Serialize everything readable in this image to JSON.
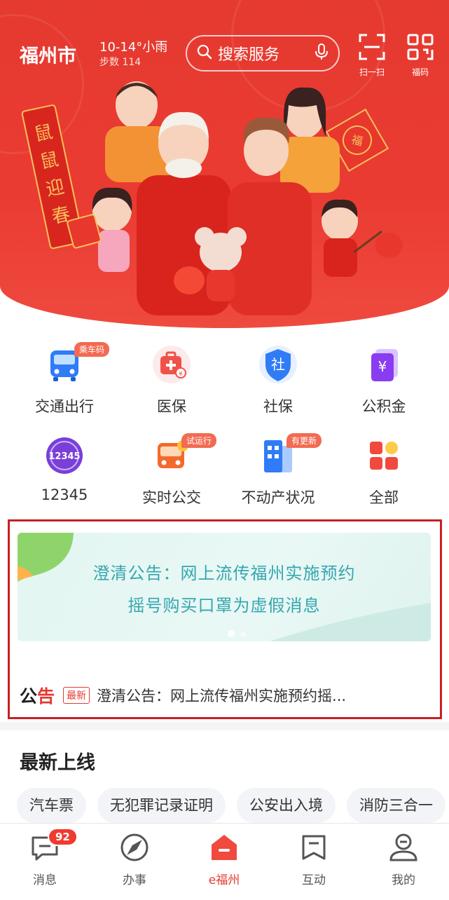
{
  "header": {
    "city": "福州市",
    "weather_temp": "10-14°小雨",
    "weather_steps": "步数 114",
    "search_placeholder": "搜索服务",
    "scan_label": "扫一扫",
    "fucode_label": "福码"
  },
  "services": [
    {
      "label": "交通出行",
      "tag": "乘车码",
      "icon": "bus-icon"
    },
    {
      "label": "医保",
      "tag": "",
      "icon": "medical-kit-icon"
    },
    {
      "label": "社保",
      "tag": "",
      "icon": "shield-icon"
    },
    {
      "label": "公积金",
      "tag": "",
      "icon": "yuan-card-icon"
    },
    {
      "label": "12345",
      "tag": "",
      "icon": "hotline-12345-icon"
    },
    {
      "label": "实时公交",
      "tag": "试运行",
      "icon": "realtime-bus-icon"
    },
    {
      "label": "不动产状况",
      "tag": "有更新",
      "icon": "building-icon"
    },
    {
      "label": "全部",
      "tag": "",
      "icon": "grid-all-icon"
    }
  ],
  "notice": {
    "banner_line1": "澄清公告：网上流传福州实施预约",
    "banner_line2": "摇号购买口罩为虚假消息",
    "ann_label_a": "公",
    "ann_label_b": "告",
    "badge": "最新",
    "text": "澄清公告：网上流传福州实施预约摇..."
  },
  "new_online": {
    "title": "最新上线",
    "chips": [
      "汽车票",
      "无犯罪记录证明",
      "公安出入境",
      "消防三合一"
    ]
  },
  "tabbar": {
    "items": [
      {
        "label": "消息",
        "badge": "92"
      },
      {
        "label": "办事",
        "badge": ""
      },
      {
        "label": "e福州",
        "badge": ""
      },
      {
        "label": "互动",
        "badge": ""
      },
      {
        "label": "我的",
        "badge": ""
      }
    ],
    "active_index": 2
  },
  "colors": {
    "brand_red": "#e53a30",
    "notice_teal": "#36a6b0",
    "frame_red": "#c81f25"
  }
}
